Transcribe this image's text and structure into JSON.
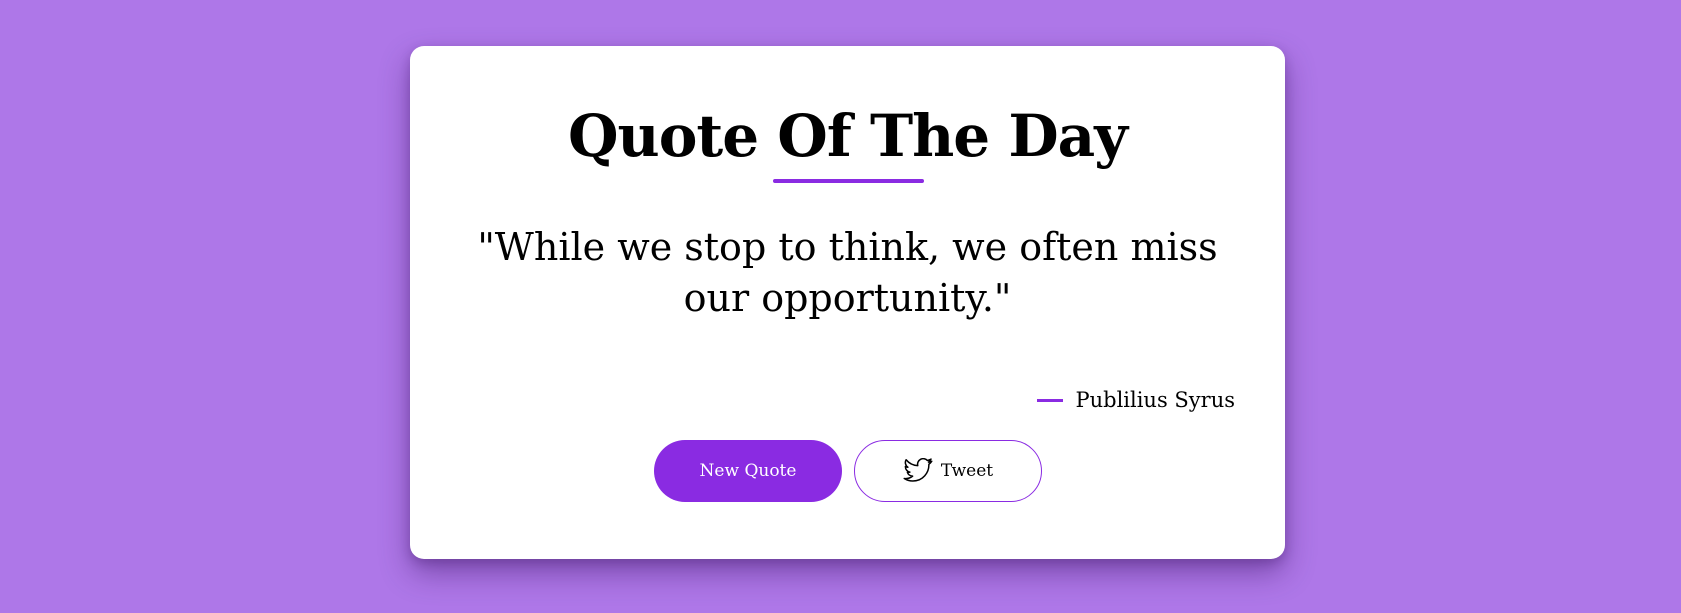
{
  "header": {
    "title": "Quote Of The Day"
  },
  "quote": {
    "text": "\"While we stop to think, we often miss our opportunity.\"",
    "author": "Publilius Syrus"
  },
  "actions": {
    "new_quote_label": "New Quote",
    "tweet_label": "Tweet",
    "tweet_icon": "twitter-bird-icon"
  },
  "colors": {
    "background": "#ae77e8",
    "accent": "#8a2be2",
    "card": "#ffffff"
  }
}
